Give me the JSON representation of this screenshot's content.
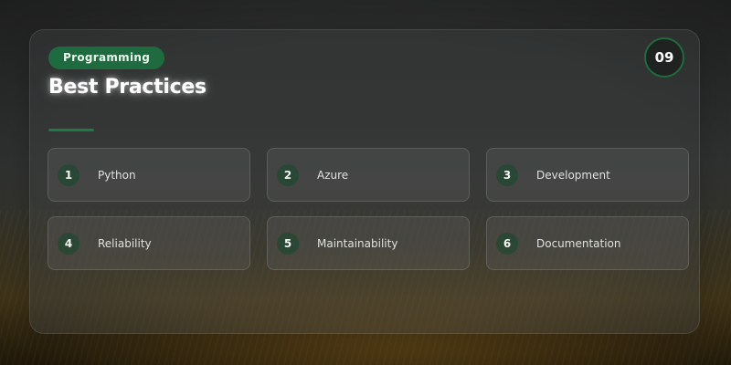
{
  "tag": "Programming",
  "title": "Best Practices",
  "page_number": "09",
  "colors": {
    "accent": "#1e6b3f",
    "card_background": "rgba(62,64,64,0.42)",
    "text": "#e6e8e6"
  },
  "items": [
    {
      "number": "1",
      "label": "Python"
    },
    {
      "number": "2",
      "label": "Azure"
    },
    {
      "number": "3",
      "label": "Development"
    },
    {
      "number": "4",
      "label": "Reliability"
    },
    {
      "number": "5",
      "label": "Maintainability"
    },
    {
      "number": "6",
      "label": "Documentation"
    }
  ]
}
